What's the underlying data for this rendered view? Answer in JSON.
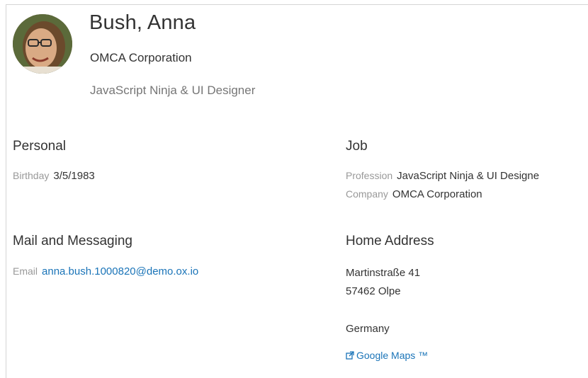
{
  "contact": {
    "name": "Bush, Anna",
    "company": "OMCA Corporation",
    "position": "JavaScript Ninja & UI Designer"
  },
  "personal": {
    "title": "Personal",
    "birthday_label": "Birthday",
    "birthday_value": "3/5/1983"
  },
  "job": {
    "title": "Job",
    "profession_label": "Profession",
    "profession_value": "JavaScript Ninja & UI Designe",
    "company_label": "Company",
    "company_value": "OMCA Corporation"
  },
  "mail": {
    "title": "Mail and Messaging",
    "email_label": "Email",
    "email_value": "anna.bush.1000820@demo.ox.io"
  },
  "address": {
    "title": "Home Address",
    "street": "Martinstraße 41",
    "city": "57462 Olpe",
    "country": "Germany",
    "maps_link": "Google Maps ™"
  },
  "colors": {
    "link": "#1a74b8",
    "label": "#999999",
    "text": "#333333"
  }
}
